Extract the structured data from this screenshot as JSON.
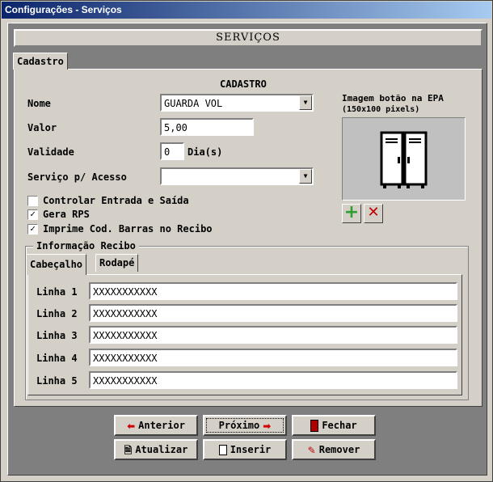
{
  "window": {
    "title": "Configurações - Serviços"
  },
  "header": {
    "title": "SERVIÇOS"
  },
  "tabs": [
    {
      "label": "Cadastro"
    }
  ],
  "cadastro": {
    "title": "CADASTRO",
    "nome_label": "Nome",
    "nome_value": "GUARDA VOL",
    "valor_label": "Valor",
    "valor_value": "5,00",
    "validade_label": "Validade",
    "validade_value": "0",
    "validade_unit": "Dia(s)",
    "servico_label": "Serviço p/ Acesso",
    "servico_value": ""
  },
  "checkboxes": [
    {
      "label": "Controlar Entrada e Saída",
      "checked": false
    },
    {
      "label": "Gera RPS",
      "checked": true
    },
    {
      "label": "Imprime Cod. Barras no Recibo",
      "checked": true
    }
  ],
  "image_panel": {
    "title": "Imagem botão na EPA",
    "subtitle": "(150x100 pixels)",
    "icon": "locker-icon"
  },
  "recibo": {
    "group_label": "Informação Recibo",
    "tabs": [
      {
        "label": "Cabeçalho"
      },
      {
        "label": "Rodapé"
      }
    ],
    "lines": [
      {
        "label": "Linha 1",
        "value": "XXXXXXXXXXX"
      },
      {
        "label": "Linha 2",
        "value": "XXXXXXXXXXX"
      },
      {
        "label": "Linha 3",
        "value": "XXXXXXXXXXX"
      },
      {
        "label": "Linha 4",
        "value": "XXXXXXXXXXX"
      },
      {
        "label": "Linha 5",
        "value": "XXXXXXXXXXX"
      }
    ]
  },
  "buttons": {
    "anterior": "Anterior",
    "proximo": "Próximo",
    "fechar": "Fechar",
    "atualizar": "Atualizar",
    "inserir": "Inserir",
    "remover": "Remover"
  },
  "colors": {
    "title_start": "#0a246a",
    "title_end": "#a6caf0",
    "add_green": "#2e9e2e",
    "remove_red": "#c00000",
    "arrow_red": "#d00000"
  }
}
